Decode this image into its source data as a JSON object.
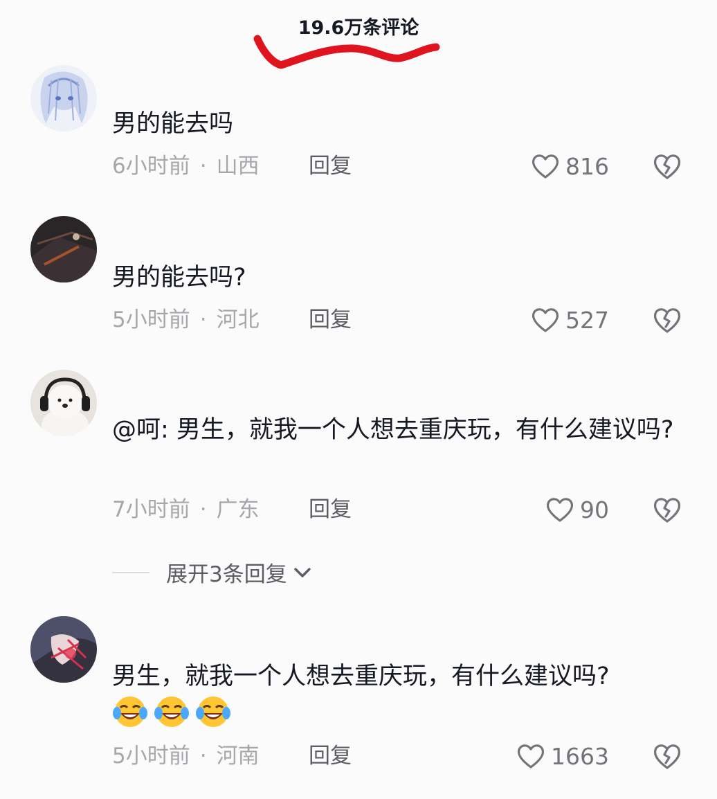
{
  "header": {
    "count_label": "19.6万条评论"
  },
  "colors": {
    "scribble": "#e0141e",
    "meta": "#a6a7ab",
    "like": "#737479"
  },
  "comments": [
    {
      "text": "男的能去吗",
      "time": "6小时前",
      "location": "山西",
      "reply": "回复",
      "likes": "816"
    },
    {
      "text": "男的能去吗?",
      "time": "5小时前",
      "location": "河北",
      "reply": "回复",
      "likes": "527"
    },
    {
      "text": "@呵: 男生，就我一个人想去重庆玩，有什么建议吗?",
      "time": "7小时前",
      "location": "广东",
      "reply": "回复",
      "likes": "90",
      "expand_replies": "展开3条回复"
    },
    {
      "text": "男生，就我一个人想去重庆玩，有什么建议吗?",
      "emojis": [
        "laugh-cry-icon",
        "laugh-cry-icon",
        "laugh-cry-icon"
      ],
      "time": "5小时前",
      "location": "河南",
      "reply": "回复",
      "likes": "1663"
    }
  ]
}
